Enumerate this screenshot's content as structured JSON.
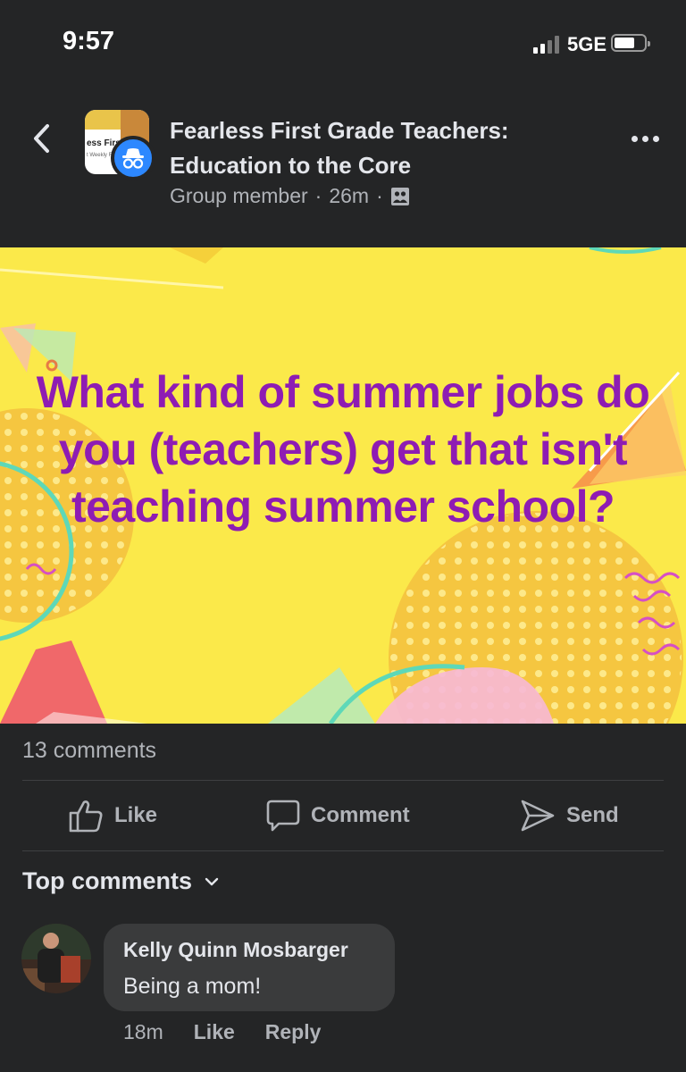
{
  "status_bar": {
    "time": "9:57",
    "network": "5GE",
    "signal_bars_filled": 2,
    "signal_bars_total": 4
  },
  "header": {
    "group_name": "Fearless First Grade Teachers: Education to the Core",
    "membership": "Group member",
    "separator": "·",
    "time_ago": "26m",
    "privacy_icon": "group-icon",
    "avatar_text_line1": "ess First G",
    "avatar_text_line2": "t Weekly Freel"
  },
  "post": {
    "image_text": "What kind of summer jobs do you (teachers) get that isn't teaching summer school?",
    "image_bg_color": "#fbe94a",
    "text_color": "#8e1cb3"
  },
  "engagement": {
    "comment_count": "13 comments"
  },
  "actions": {
    "like": "Like",
    "comment": "Comment",
    "send": "Send"
  },
  "comments_section": {
    "sort_label": "Top comments"
  },
  "comments": [
    {
      "author": "Kelly Quinn Mosbarger",
      "text": "Being a mom!",
      "time": "18m",
      "like_label": "Like",
      "reply_label": "Reply"
    }
  ],
  "colors": {
    "background": "#242526",
    "bubble": "#3a3b3c",
    "secondary_text": "#b0b3b8",
    "accent_badge": "#2d88ff"
  }
}
